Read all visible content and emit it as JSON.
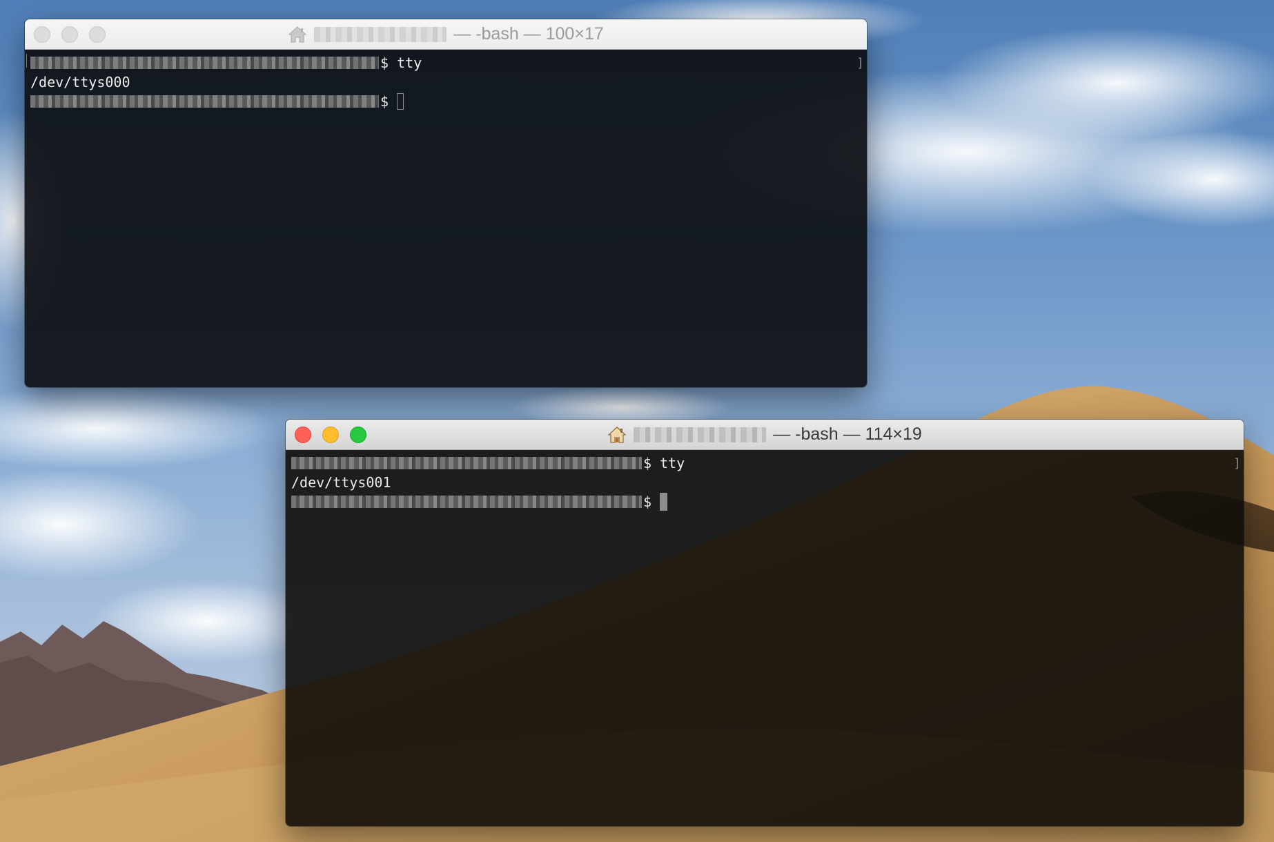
{
  "windows": [
    {
      "id": "terminal-1",
      "title_text": "— -bash — 100×17",
      "active": false,
      "lines": [
        {
          "kind": "prompt",
          "command": "$ tty"
        },
        {
          "kind": "output",
          "text": "/dev/ttys000"
        },
        {
          "kind": "prompt",
          "command": "$"
        }
      ],
      "edge_mark": "]"
    },
    {
      "id": "terminal-2",
      "title_text": "— -bash — 114×19",
      "active": true,
      "lines": [
        {
          "kind": "prompt",
          "command": "$ tty"
        },
        {
          "kind": "output",
          "text": "/dev/ttys001"
        },
        {
          "kind": "prompt",
          "command": "$"
        }
      ],
      "edge_mark": "]"
    }
  ],
  "icons": {
    "title_icon": "home-icon",
    "close": "close-icon",
    "minimize": "minimize-icon",
    "zoom": "zoom-icon"
  },
  "colors": {
    "close": "#fe5f57",
    "minimize": "#febc2e",
    "zoom": "#28c840",
    "terminal_bg": "#0e1014",
    "terminal_text": "#ececec"
  }
}
